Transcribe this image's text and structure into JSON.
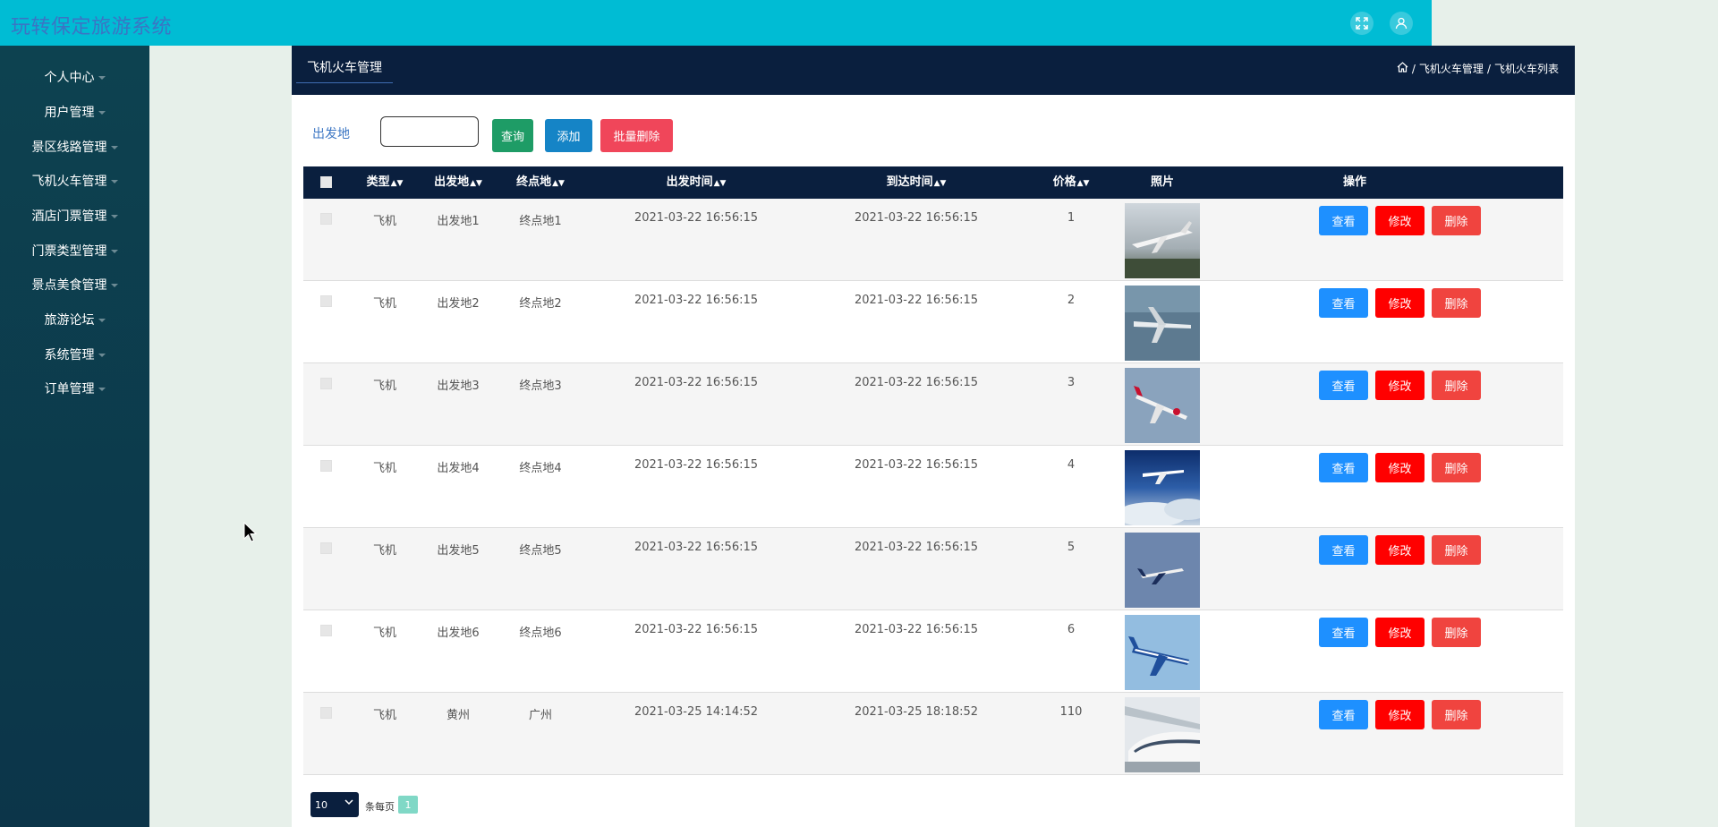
{
  "app": {
    "title": "玩转保定旅游系统"
  },
  "topbar_icons": [
    "fullscreen-icon",
    "user-icon"
  ],
  "sidebar": {
    "items": [
      {
        "label": "个人中心"
      },
      {
        "label": "用户管理"
      },
      {
        "label": "景区线路管理"
      },
      {
        "label": "飞机火车管理"
      },
      {
        "label": "酒店门票管理"
      },
      {
        "label": "门票类型管理"
      },
      {
        "label": "景点美食管理"
      },
      {
        "label": "旅游论坛"
      },
      {
        "label": "系统管理"
      },
      {
        "label": "订单管理"
      }
    ]
  },
  "header": {
    "tab": "飞机火车管理",
    "breadcrumb": [
      "飞机火车管理",
      "飞机火车列表"
    ]
  },
  "search": {
    "label": "出发地",
    "value": "",
    "query_button": "查询",
    "add_button": "添加",
    "batch_delete_button": "批量删除"
  },
  "table": {
    "columns": [
      "类型",
      "出发地",
      "终点地",
      "出发时间",
      "到达时间",
      "价格",
      "照片",
      "操作"
    ],
    "rows": [
      {
        "type": "飞机",
        "from": "出发地1",
        "to": "终点地1",
        "depart": "2021-03-22 16:56:15",
        "arrive": "2021-03-22 16:56:15",
        "price": "1"
      },
      {
        "type": "飞机",
        "from": "出发地2",
        "to": "终点地2",
        "depart": "2021-03-22 16:56:15",
        "arrive": "2021-03-22 16:56:15",
        "price": "2"
      },
      {
        "type": "飞机",
        "from": "出发地3",
        "to": "终点地3",
        "depart": "2021-03-22 16:56:15",
        "arrive": "2021-03-22 16:56:15",
        "price": "3"
      },
      {
        "type": "飞机",
        "from": "出发地4",
        "to": "终点地4",
        "depart": "2021-03-22 16:56:15",
        "arrive": "2021-03-22 16:56:15",
        "price": "4"
      },
      {
        "type": "飞机",
        "from": "出发地5",
        "to": "终点地5",
        "depart": "2021-03-22 16:56:15",
        "arrive": "2021-03-22 16:56:15",
        "price": "5"
      },
      {
        "type": "飞机",
        "from": "出发地6",
        "to": "终点地6",
        "depart": "2021-03-22 16:56:15",
        "arrive": "2021-03-22 16:56:15",
        "price": "6"
      },
      {
        "type": "飞机",
        "from": "黄州",
        "to": "广州",
        "depart": "2021-03-25 14:14:52",
        "arrive": "2021-03-25 18:18:52",
        "price": "110"
      }
    ],
    "actions": {
      "view": "查看",
      "edit": "修改",
      "delete": "删除"
    }
  },
  "pagination": {
    "page_size": "10",
    "page_size_label": "条每页",
    "current_page": "1"
  },
  "colors": {
    "topbar": "#00bcd4",
    "header": "#0a1f3e",
    "query_btn": "#1e9c66",
    "add_btn": "#1584c6",
    "batch_delete_btn": "#f0465a",
    "view_btn": "#1e90ff",
    "edit_btn": "#ff0000",
    "delete_btn": "#f0443f"
  }
}
